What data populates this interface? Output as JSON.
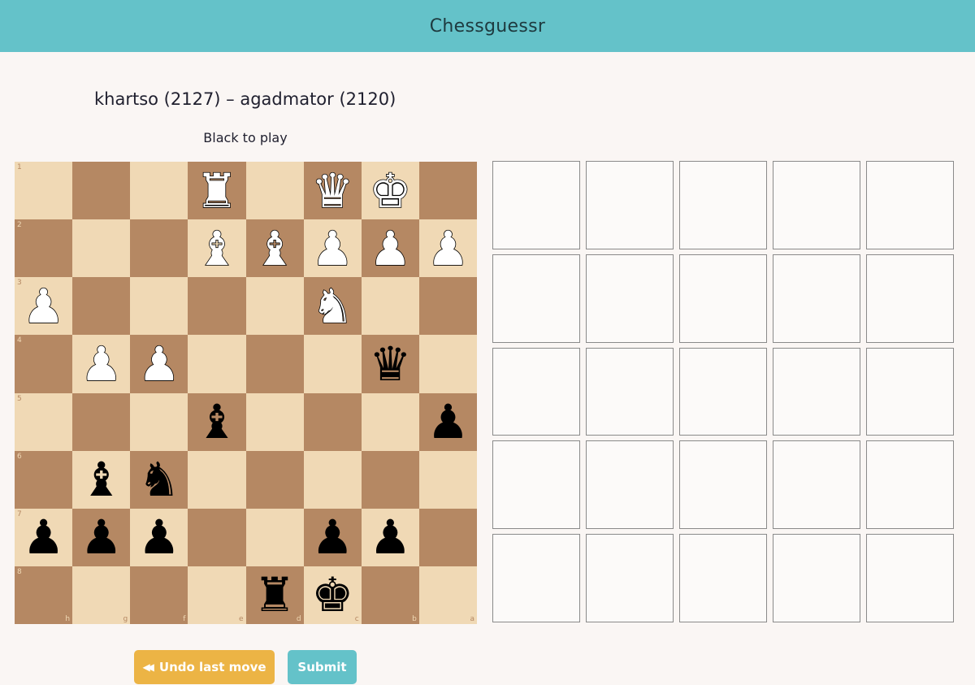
{
  "app": {
    "title": "Chessguessr"
  },
  "game": {
    "title": "khartso (2127) – agadmator (2120)",
    "to_play": "Black to play"
  },
  "board": {
    "ranks": [
      "1",
      "2",
      "3",
      "4",
      "5",
      "6",
      "7",
      "8"
    ],
    "files": [
      "h",
      "g",
      "f",
      "e",
      "d",
      "c",
      "b",
      "a"
    ],
    "rows": [
      [
        "",
        "",
        "",
        "wR",
        "",
        "wQ",
        "wK",
        ""
      ],
      [
        "",
        "",
        "",
        "wB",
        "wB",
        "wP",
        "wP",
        "wP"
      ],
      [
        "wP",
        "",
        "",
        "",
        "",
        "wN",
        "",
        ""
      ],
      [
        "",
        "wP",
        "wP",
        "",
        "",
        "",
        "bQ",
        ""
      ],
      [
        "",
        "",
        "",
        "bB",
        "",
        "",
        "",
        "bP"
      ],
      [
        "",
        "bB",
        "bN",
        "",
        "",
        "",
        "",
        ""
      ],
      [
        "bP",
        "bP",
        "bP",
        "",
        "",
        "bP",
        "bP",
        ""
      ],
      [
        "",
        "",
        "",
        "",
        "bR",
        "bK",
        "",
        ""
      ]
    ],
    "colors": {
      "light": "#f0d9b5",
      "dark": "#b58863"
    }
  },
  "guess_grid": {
    "rows": 5,
    "cols": 5
  },
  "buttons": {
    "undo_icon": "rewind-icon",
    "undo_label": "Undo last move",
    "submit_label": "Submit"
  },
  "colors": {
    "header": "#64c2c9",
    "undo": "#ecb445",
    "submit": "#64c2c9"
  }
}
